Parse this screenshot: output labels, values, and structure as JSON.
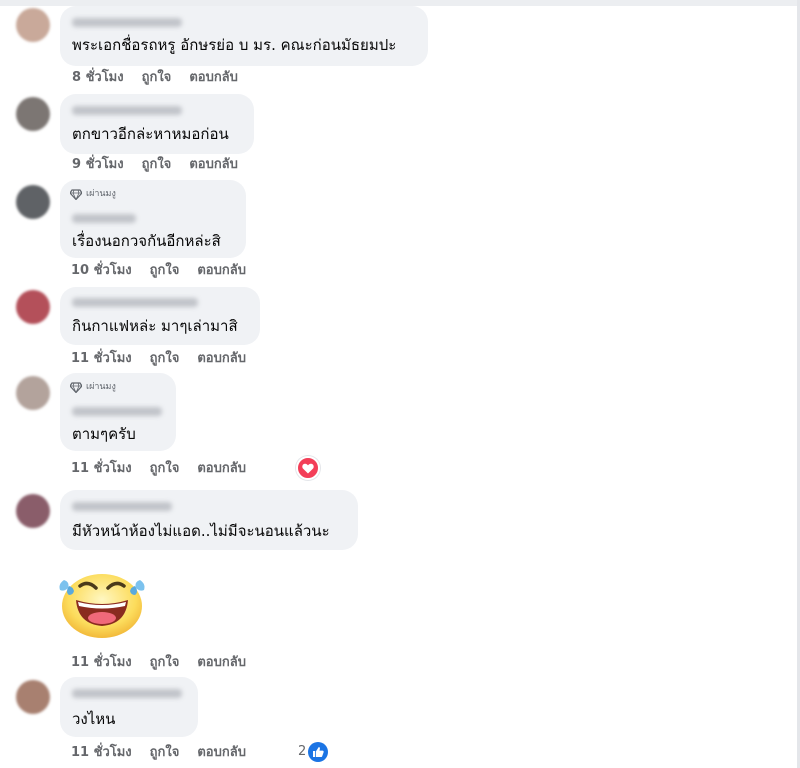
{
  "comments": [
    {
      "avatar_color": "#c9a99a",
      "text": "พระเอกชื่อรถหรู อักษรย่อ บ มร. คณะก่อนมัธยมปะ",
      "time": "8 ชั่วโมง",
      "like_label": "ถูกใจ",
      "reply_label": "ตอบกลับ"
    },
    {
      "avatar_color": "#7c7673",
      "text": "ตกขาวอีกล่ะหาหมอก่อน",
      "time": "9 ชั่วโมง",
      "like_label": "ถูกใจ",
      "reply_label": "ตอบกลับ"
    },
    {
      "avatar_color": "#5f6266",
      "badge": "เผ่านมงู",
      "text": "เรื่องนอกวจกันอีกหล่ะสิ",
      "time": "10 ชั่วโมง",
      "like_label": "ถูกใจ",
      "reply_label": "ตอบกลับ"
    },
    {
      "avatar_color": "#b4505a",
      "text": "กินกาแฟหล่ะ มาๆเล่ามาสิ",
      "time": "11 ชั่วโมง",
      "like_label": "ถูกใจ",
      "reply_label": "ตอบกลับ"
    },
    {
      "avatar_color": "#b3a39c",
      "badge": "เผ่านมงู",
      "text": "ตามๆครับ",
      "time": "11 ชั่วโมง",
      "like_label": "ถูกใจ",
      "reply_label": "ตอบกลับ",
      "reaction": "heart-icon"
    },
    {
      "avatar_color": "#8a5d6a",
      "text": "มีหัวหน้าห้องไม่แอด..ไม่มีจะนอนแล้วนะ",
      "sticker": "laughing-tears-emoji",
      "time": "11 ชั่วโมง",
      "like_label": "ถูกใจ",
      "reply_label": "ตอบกลับ"
    },
    {
      "avatar_color": "#a88070",
      "text": "วงไหน",
      "time": "11 ชั่วโมง",
      "like_label": "ถูกใจ",
      "reply_label": "ตอบกลับ",
      "like_count": "2",
      "reaction": "like-icon"
    }
  ],
  "colors": {
    "bubble": "#f0f2f5",
    "action_text": "#65676b",
    "like_blue": "#1b74e4",
    "heart_red": "#f33e58"
  }
}
